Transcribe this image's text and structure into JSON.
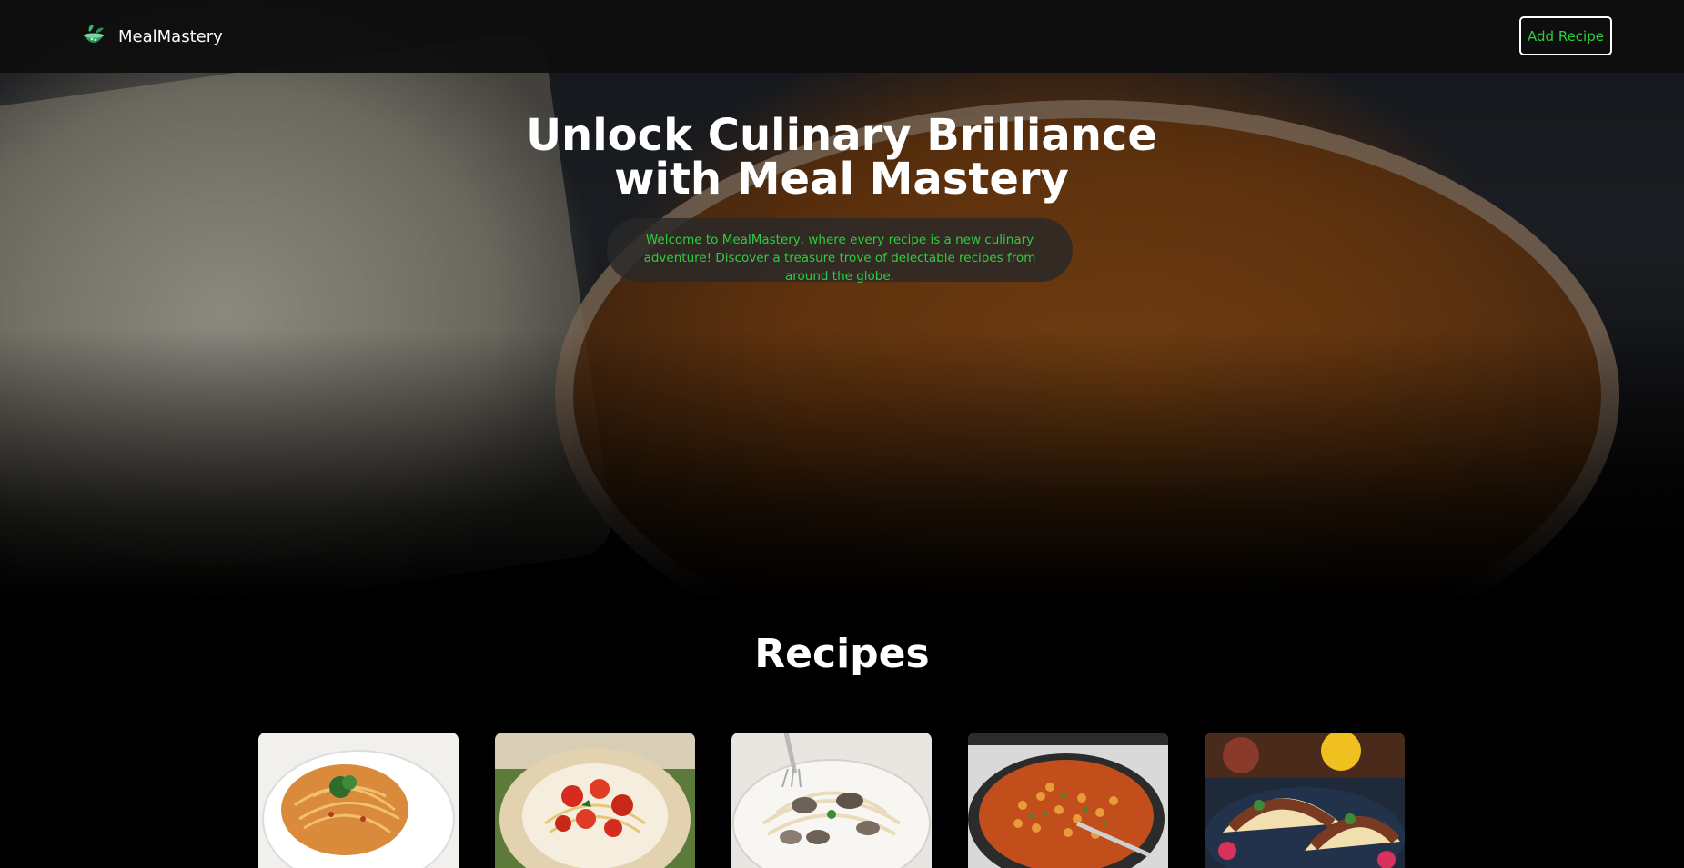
{
  "navbar": {
    "brand_name": "MealMastery",
    "logo_icon": "bowl-leaf-logo-icon",
    "add_recipe_label": "Add Recipe"
  },
  "hero": {
    "title": "Unlock Culinary Brilliance with Meal Mastery",
    "subtitle": "Welcome to MealMastery, where every recipe is a new culinary adventure! Discover a treasure trove of delectable recipes from around the globe."
  },
  "recipes": {
    "section_title": "Recipes",
    "cards": [
      {
        "image": "spaghetti-photo"
      },
      {
        "image": "tomato-pasta-photo"
      },
      {
        "image": "mushroom-pasta-photo"
      },
      {
        "image": "chickpea-curry-pan-photo"
      },
      {
        "image": "tacos-photo"
      }
    ]
  },
  "colors": {
    "accent_green": "#2ecc40",
    "navbar_bg": "#0e0e0e",
    "page_bg": "#000000"
  }
}
